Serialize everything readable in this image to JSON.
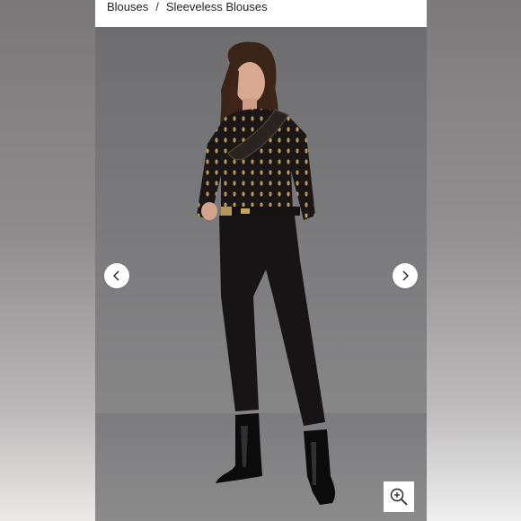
{
  "breadcrumb": {
    "items": [
      "Blouses",
      "Sleeveless Blouses"
    ],
    "separator": "/"
  },
  "gallery": {
    "prev_icon": "chevron-left-icon",
    "next_icon": "chevron-right-icon",
    "zoom_icon": "zoom-in-icon"
  },
  "colors": {
    "backdrop": "#7a7a7c",
    "garment": "#1a1716",
    "accent_gold": "#c9a45a"
  }
}
